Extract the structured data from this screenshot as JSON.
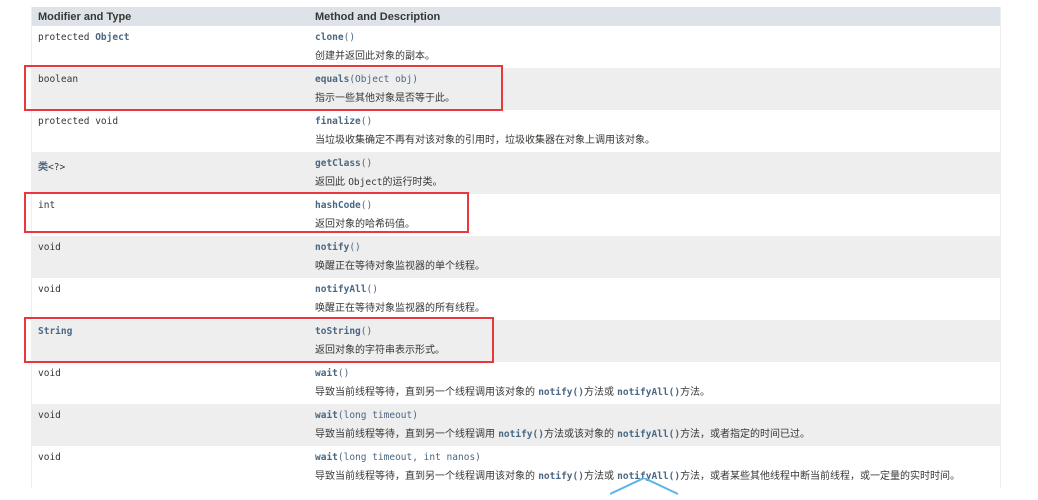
{
  "header": {
    "col1": "Modifier and Type",
    "col2": "Method and Description"
  },
  "rows": [
    {
      "mod": "protected ",
      "type_link": "Object",
      "method": "clone",
      "params": "()",
      "desc": "创建并返回此对象的副本。"
    },
    {
      "mod": "boolean",
      "method": "equals",
      "params": "(Object obj)",
      "desc": "指示一些其他对象是否等于此。"
    },
    {
      "mod": "protected void",
      "method": "finalize",
      "params": "()",
      "desc": "当垃圾收集确定不再有对该对象的引用时，垃圾收集器在对象上调用该对象。"
    },
    {
      "mod_cn": "类",
      "mod": "<?>",
      "method": "getClass",
      "params": "()",
      "desc_a": "返回此 ",
      "desc_code": "Object",
      "desc_b": "的运行时类。"
    },
    {
      "mod": "int",
      "method": "hashCode",
      "params": "()",
      "desc": "返回对象的哈希码值。"
    },
    {
      "mod": "void",
      "method": "notify",
      "params": "()",
      "desc": "唤醒正在等待对象监视器的单个线程。"
    },
    {
      "mod": "void",
      "method": "notifyAll",
      "params": "()",
      "desc": "唤醒正在等待对象监视器的所有线程。"
    },
    {
      "type_link": "String",
      "method": "toString",
      "params": "()",
      "desc": "返回对象的字符串表示形式。"
    },
    {
      "mod": "void",
      "method": "wait",
      "params": "()",
      "desc_a": "导致当前线程等待，直到另一个线程调用该对象的 ",
      "code1": "notify()",
      "desc_b": "方法或 ",
      "code2": "notifyAll()",
      "desc_c": "方法。"
    },
    {
      "mod": "void",
      "method": "wait",
      "params": "(long timeout)",
      "desc_a": "导致当前线程等待，直到另一个线程调用 ",
      "code1": "notify()",
      "desc_b": "方法或该对象的 ",
      "code2": "notifyAll()",
      "desc_c": "方法，或者指定的时间已过。"
    },
    {
      "mod": "void",
      "method": "wait",
      "params": "(long timeout, int nanos)",
      "desc_a": "导致当前线程等待，直到另一个线程调用该对象的 ",
      "code1": "notify()",
      "desc_b": "方法或 ",
      "code2": "notifyAll()",
      "desc_c": "方法，或者某些其他线程中断当前线程，或一定量的实时时间。"
    }
  ],
  "colors": {
    "header_bg": "#dee3e9",
    "alt_row_bg": "#eeeeef",
    "link": "#4a6782",
    "highlight": "#e8383d"
  }
}
